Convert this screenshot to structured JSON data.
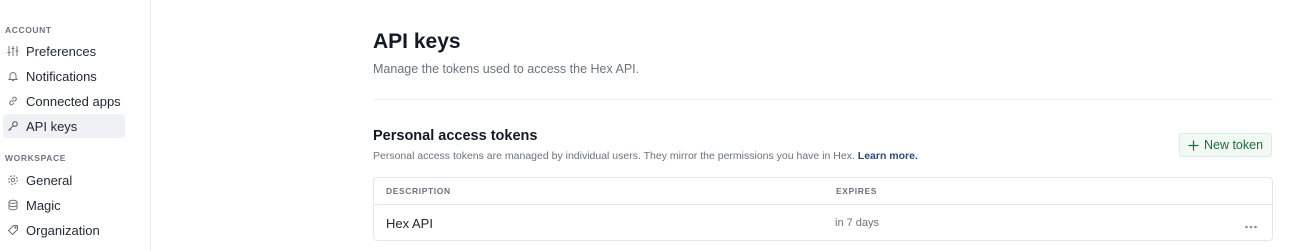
{
  "sidebar": {
    "account_label": "ACCOUNT",
    "account_items": [
      {
        "label": "Preferences",
        "icon": "sliders-icon"
      },
      {
        "label": "Notifications",
        "icon": "bell-icon"
      },
      {
        "label": "Connected apps",
        "icon": "link-icon"
      },
      {
        "label": "API keys",
        "icon": "key-icon",
        "active": true
      }
    ],
    "workspace_label": "WORKSPACE",
    "workspace_items": [
      {
        "label": "General",
        "icon": "gear-icon"
      },
      {
        "label": "Magic",
        "icon": "database-icon"
      },
      {
        "label": "Organization",
        "icon": "tag-icon"
      }
    ]
  },
  "main": {
    "title": "API keys",
    "subtitle": "Manage the tokens used to access the Hex API.",
    "section": {
      "title": "Personal access tokens",
      "description": "Personal access tokens are managed by individual users. They mirror the permissions you have in Hex.",
      "learn_more": "Learn more.",
      "new_token_label": "New token"
    },
    "table": {
      "columns": [
        "DESCRIPTION",
        "EXPIRES"
      ],
      "rows": [
        {
          "description": "Hex API",
          "expires": "in 7 days"
        }
      ]
    }
  },
  "colors": {
    "accent_green": "#1b6d3d",
    "active_bg": "#eff1f5",
    "muted_text": "#6b7380"
  }
}
